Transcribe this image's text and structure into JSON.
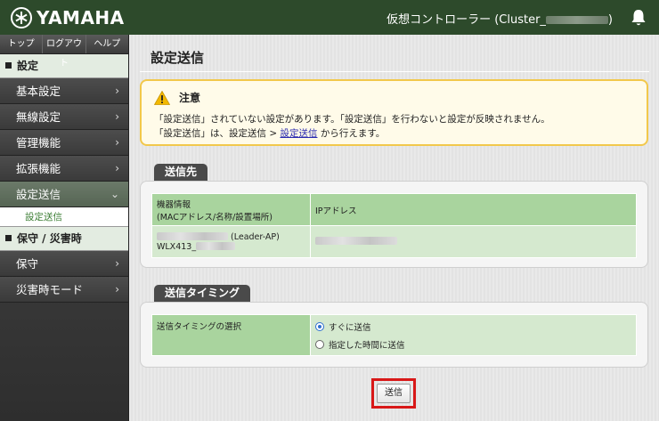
{
  "header": {
    "logo_text": "YAMAHA",
    "controller_title": "仮想コントローラー (Cluster_",
    "controller_title_end": ")",
    "brand_color": "#2d4a2b"
  },
  "sidebar": {
    "topnav": [
      "トップ",
      "ログアウト",
      "ヘルプ"
    ],
    "section1": "設定",
    "section1_items": [
      "基本設定",
      "無線設定",
      "管理機能",
      "拡張機能",
      "設定送信"
    ],
    "active_item": "設定送信",
    "sub_item": "設定送信",
    "section2": "保守 / 災害時",
    "section2_items": [
      "保守",
      "災害時モード"
    ]
  },
  "main": {
    "page_title": "設定送信",
    "notice": {
      "title": "注意",
      "line1": "「設定送信」されていない設定があります。「設定送信」を行わないと設定が反映されません。",
      "line2_prefix": "「設定送信」は、設定送信 > ",
      "line2_link": "設定送信",
      "line2_suffix": " から行えます。"
    },
    "destination": {
      "tab": "送信先",
      "col1_header_line1": "機器情報",
      "col1_header_line2": "(MACアドレス/名称/設置場所)",
      "col2_header": "IPアドレス",
      "row_role": "(Leader-AP)",
      "row_model": "WLX413_"
    },
    "timing": {
      "tab": "送信タイミング",
      "label": "送信タイミングの選択",
      "option_now": "すぐに送信",
      "option_scheduled": "指定した時間に送信",
      "selected": "すぐに送信"
    },
    "send_button": "送信"
  }
}
